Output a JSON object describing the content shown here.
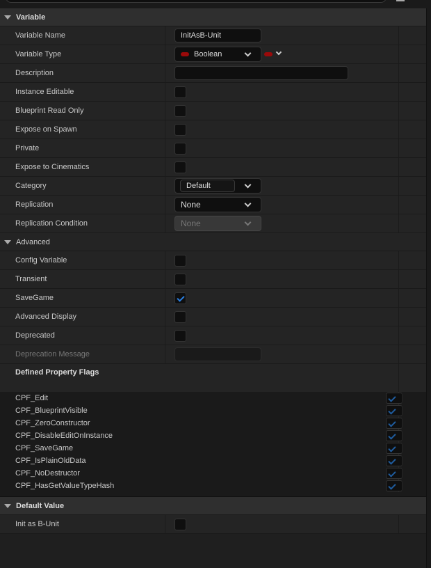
{
  "variable": {
    "title": "Variable",
    "rows": {
      "name": {
        "label": "Variable Name",
        "value": "InitAsB-Unit"
      },
      "type": {
        "label": "Variable Type",
        "value": "Boolean",
        "pin_color": "#9a0a0a"
      },
      "description": {
        "label": "Description",
        "value": ""
      },
      "instance_editable": {
        "label": "Instance Editable",
        "checked": false
      },
      "bp_read_only": {
        "label": "Blueprint Read Only",
        "checked": false
      },
      "expose_spawn": {
        "label": "Expose on Spawn",
        "checked": false
      },
      "private": {
        "label": "Private",
        "checked": false
      },
      "expose_cine": {
        "label": "Expose to Cinematics",
        "checked": false
      },
      "category": {
        "label": "Category",
        "value": "Default"
      },
      "replication": {
        "label": "Replication",
        "value": "None"
      },
      "rep_condition": {
        "label": "Replication Condition",
        "value": "None"
      }
    }
  },
  "advanced": {
    "title": "Advanced",
    "rows": {
      "config": {
        "label": "Config Variable",
        "checked": false
      },
      "transient": {
        "label": "Transient",
        "checked": false
      },
      "savegame": {
        "label": "SaveGame",
        "checked": true
      },
      "adv_display": {
        "label": "Advanced Display",
        "checked": false
      },
      "deprecated": {
        "label": "Deprecated",
        "checked": false
      },
      "deprecation_msg": {
        "label": "Deprecation Message",
        "value": ""
      }
    },
    "flags_title": "Defined Property Flags",
    "flags": [
      "CPF_Edit",
      "CPF_BlueprintVisible",
      "CPF_ZeroConstructor",
      "CPF_DisableEditOnInstance",
      "CPF_SaveGame",
      "CPF_IsPlainOldData",
      "CPF_NoDestructor",
      "CPF_HasGetValueTypeHash"
    ]
  },
  "default_value": {
    "title": "Default Value",
    "rows": {
      "init": {
        "label": "Init as B-Unit",
        "checked": false
      }
    }
  },
  "accent": "#2a7fe0"
}
